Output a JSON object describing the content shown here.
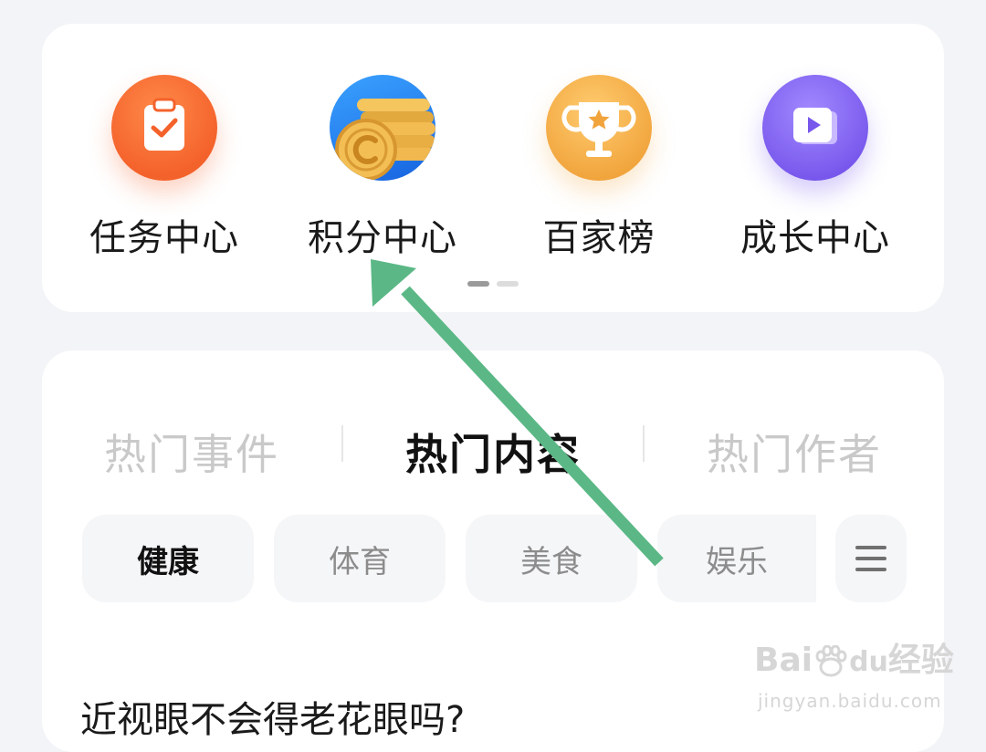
{
  "shortcuts": [
    {
      "label": "任务中心",
      "icon": "clipboard-check-icon"
    },
    {
      "label": "积分中心",
      "icon": "coin-stack-icon"
    },
    {
      "label": "百家榜",
      "icon": "trophy-icon"
    },
    {
      "label": "成长中心",
      "icon": "video-play-icon"
    }
  ],
  "pager": {
    "active_index": 0,
    "count": 2
  },
  "hot_tabs": [
    {
      "label": "热门事件",
      "active": false
    },
    {
      "label": "热门内容",
      "active": true
    },
    {
      "label": "热门作者",
      "active": false
    }
  ],
  "categories": [
    {
      "label": "健康",
      "active": true
    },
    {
      "label": "体育",
      "active": false
    },
    {
      "label": "美食",
      "active": false
    },
    {
      "label": "娱乐",
      "active": false
    }
  ],
  "category_menu_icon": "hamburger-menu-icon",
  "article": {
    "title": "近视眼不会得老花眼吗?"
  },
  "annotation": {
    "arrow_color": "#5bb886",
    "points_to": "积分中心"
  },
  "watermark": {
    "logo": "Bai经验",
    "logo_du": "du",
    "url": "jingyan.baidu.com"
  },
  "colors": {
    "task_icon": "#f4622b",
    "points_icon": "#1763e0",
    "rank_icon": "#f1a43c",
    "growth_icon": "#7757ec",
    "active_text": "#111111",
    "inactive_text": "#c9c9c9"
  }
}
